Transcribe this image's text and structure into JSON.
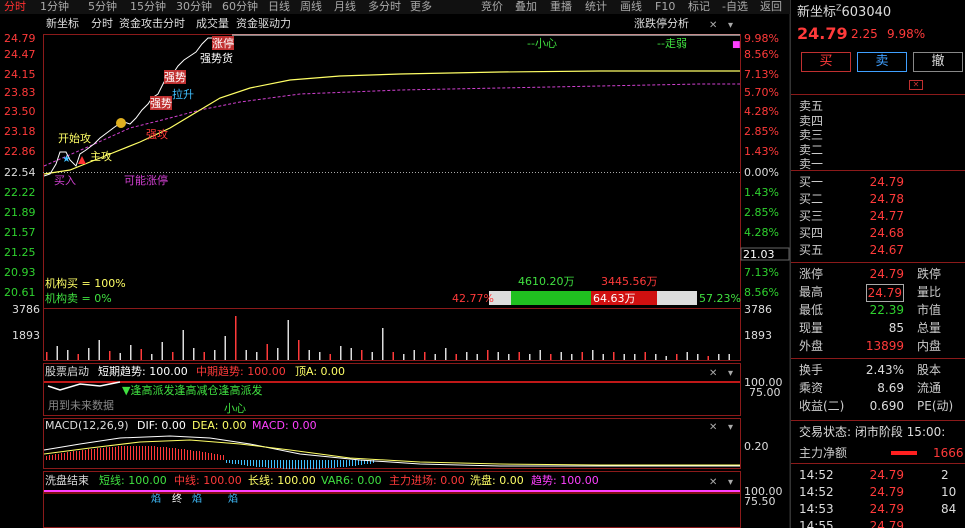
{
  "toolbar": {
    "left_items": [
      "分时",
      "1分钟",
      "5分钟",
      "15分钟",
      "30分钟",
      "60分钟",
      "日线",
      "周线",
      "月线",
      "多分时",
      "更多"
    ],
    "right_items": [
      "竞价",
      "叠加",
      "重播",
      "统计",
      "画线",
      "F10",
      "标记",
      "-自选",
      "返回"
    ]
  },
  "chart": {
    "title_items": [
      "新坐标",
      "分时",
      "资金攻击分时",
      "成交量",
      "资金驱动力"
    ],
    "limit_label": "涨跌停分析",
    "price_labels": [
      "24.79",
      "24.47",
      "24.15",
      "23.83",
      "23.50",
      "23.18",
      "22.86",
      "22.54",
      "22.22",
      "21.89",
      "21.57",
      "21.25",
      "20.93",
      "20.61"
    ],
    "pct_labels": [
      "9.98%",
      "8.56%",
      "7.13%",
      "5.70%",
      "4.28%",
      "2.85%",
      "1.43%",
      "0.00%",
      "1.43%",
      "2.85%",
      "4.28%",
      "5.70%",
      "7.13%",
      "8.56%"
    ],
    "current_price_tag": "21.03",
    "annotations": {
      "kaishigong": "开始攻",
      "zhugong": "主攻",
      "mairu": "买入",
      "kenengzhangting": "可能涨停",
      "lasheng": "拉升",
      "qianggong": "强攻",
      "qiangshi1": "强势",
      "qiangshi2": "强势",
      "zhangting": "涨停",
      "qiangdan": "强势货",
      "xiaoxin": "--小心",
      "zouruo": "--走弱"
    },
    "flow": {
      "buy_label": "机构买 = 100%",
      "sell_label": "机构卖 = 0%",
      "amount1": "4610.20万",
      "amount2": "3445.56万",
      "pct_left": "42.77%",
      "amount3": "64.63万",
      "pct_right": "57.23%"
    },
    "volume": {
      "top": "3786",
      "mid": "1893",
      "right_top": "3786",
      "right_mid": "1893"
    },
    "sub1": {
      "items": [
        "股票启动",
        "短期趋势: 100.00",
        "中期趋势: 100.00",
        "顶A: 0.00"
      ],
      "y_top": "100.00",
      "y_mid": "75.00",
      "note": "用到未来数据",
      "signal": "▼逢高派发逢高减仓逢高派发",
      "xiaoxin": "小心"
    },
    "macd": {
      "items": [
        "MACD(12,26,9)",
        "DIF: 0.00",
        "DEA: 0.00",
        "MACD: 0.00"
      ],
      "y_val": "0.20"
    },
    "wash": {
      "items": [
        "洗盘结束",
        "短线: 100.00",
        "中线: 100.00",
        "长线: 100.00",
        "VAR6: 0.00",
        "主力进场: 0.00",
        "洗盘: 0.00",
        "趋势: 100.00"
      ],
      "y_top": "100.00",
      "y_mid": "75.50",
      "marks": [
        "焰",
        "终",
        "焰",
        "焰"
      ]
    }
  },
  "panel": {
    "name": "新坐标",
    "superscript": "Z",
    "code": "603040",
    "price": "24.79",
    "change": "2.25",
    "change_pct": "9.98%",
    "buttons": [
      "买",
      "卖",
      "撤"
    ],
    "sell_levels": [
      "卖五",
      "卖四",
      "卖三",
      "卖二",
      "卖一"
    ],
    "buy_levels": [
      {
        "label": "买一",
        "price": "24.79"
      },
      {
        "label": "买二",
        "price": "24.78"
      },
      {
        "label": "买三",
        "price": "24.77"
      },
      {
        "label": "买四",
        "price": "24.68"
      },
      {
        "label": "买五",
        "price": "24.67"
      }
    ],
    "stats": [
      {
        "l": "涨停",
        "v": "24.79",
        "r": "跌停",
        "c": "red"
      },
      {
        "l": "最高",
        "v": "24.79",
        "r": "量比",
        "c": "red"
      },
      {
        "l": "最低",
        "v": "22.39",
        "r": "市值",
        "c": "green"
      },
      {
        "l": "现量",
        "v": "85",
        "r": "总量",
        "c": "white"
      },
      {
        "l": "外盘",
        "v": "13899",
        "r": "内盘",
        "c": "red"
      }
    ],
    "stats2": [
      {
        "l": "换手",
        "v": "2.43%",
        "r": "股本",
        "c": "white"
      },
      {
        "l": "乘资",
        "v": "8.69",
        "r": "流通",
        "c": "white"
      },
      {
        "l": "收益(二)",
        "v": "0.690",
        "r": "PE(动)",
        "c": "white"
      }
    ],
    "trade_state": "交易状态: 闭市阶段 15:00:",
    "net_flow_label": "主力净额",
    "net_flow_value": "1666",
    "ticks": [
      {
        "t": "14:52",
        "p": "24.79",
        "v": "2"
      },
      {
        "t": "14:52",
        "p": "24.79",
        "v": "10"
      },
      {
        "t": "14:53",
        "p": "24.79",
        "v": "84"
      },
      {
        "t": "14:55",
        "p": "24.79",
        "v": ""
      }
    ]
  },
  "colors": {
    "up": "#ff3a3a",
    "down": "#2fd22f",
    "price_line": "#ffffff",
    "avg_line": "#ffff66",
    "ma_line": "#d040d0",
    "grid": "#8b1a1a"
  }
}
